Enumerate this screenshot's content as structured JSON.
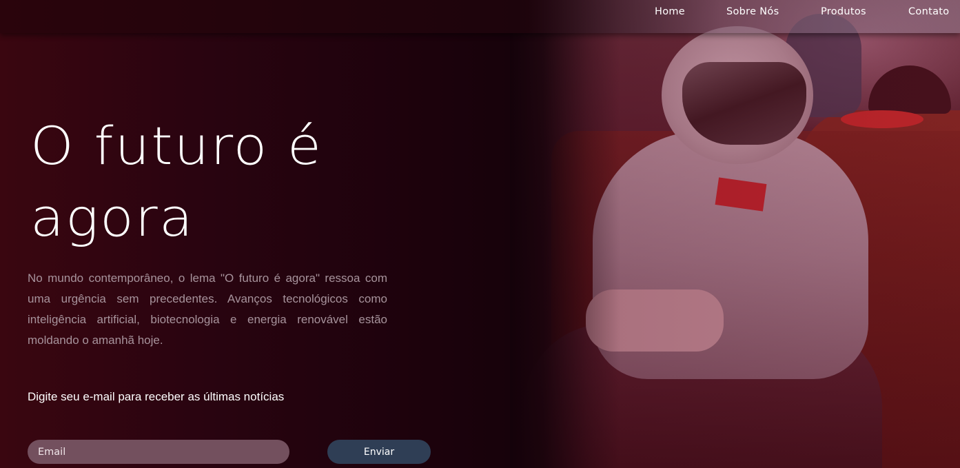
{
  "nav": {
    "items": [
      {
        "label": "Home"
      },
      {
        "label": "Sobre Nós"
      },
      {
        "label": "Produtos"
      },
      {
        "label": "Contato"
      }
    ]
  },
  "hero": {
    "title_line1": "O futuro é",
    "title_line2": "agora",
    "description": "No mundo contemporâneo, o lema \"O futuro é agora\" ressoa com uma urgência sem precedentes. Avanços tecnológicos como inteligência artificial, biotecnologia e energia renovável estão moldando o amanhã hoje.",
    "newsletter_label": "Digite seu e-mail para receber as últimas notícias",
    "email_placeholder": "Email",
    "email_value": "",
    "submit_label": "Enviar"
  },
  "colors": {
    "background": "#14020a",
    "input_bg": "#73505e",
    "button_bg": "#2f3e55",
    "text_muted": "#a7939c"
  },
  "image": {
    "subject": "person-in-astronaut-helmet-playing-video-game-on-sofa"
  }
}
